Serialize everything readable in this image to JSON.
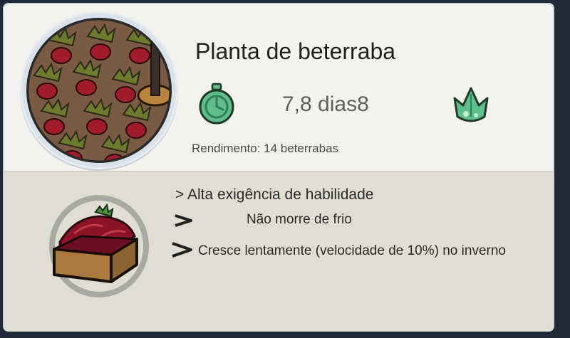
{
  "card": {
    "title": "Planta de beterraba",
    "grow_time": "7,8 dias8",
    "yield": "Rendimento: 14 beterrabas",
    "traits": [
      "> Alta exigência de habilidade",
      "Não morre de frio",
      "Cresce lentamente (velocidade de 10%) no inverno"
    ]
  },
  "icons": {
    "portrait": "beet-field-portrait",
    "timer": "stopwatch-icon",
    "plant": "sprout-icon",
    "crate": "beet-crate-icon",
    "bullet": "chevron-right-icon"
  },
  "colors": {
    "card_bg": "#f3f2ec",
    "lower_panel_bg": "#e0ddd2",
    "icon_green": "#5fbe8a",
    "beet_red": "#a01c2c",
    "leaf_green": "#6b7a2c"
  }
}
